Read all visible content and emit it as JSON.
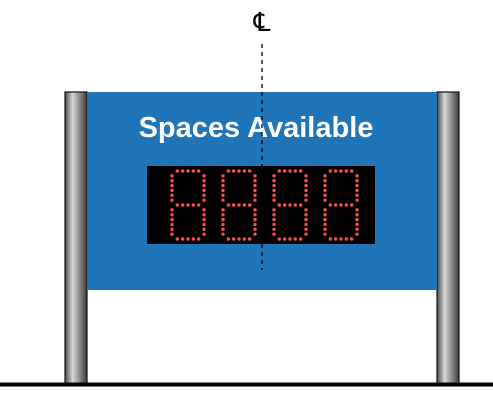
{
  "centerline": {
    "symbol": "℄"
  },
  "sign": {
    "title": "Spaces Available",
    "panel_color": "#1f75b8",
    "display": {
      "digits": 4,
      "led_color": "#ff4c4c",
      "background_color": "#000000"
    }
  },
  "posts": {
    "count": 2,
    "color": "#8a8a8a"
  },
  "ground": {
    "color": "#000000"
  }
}
